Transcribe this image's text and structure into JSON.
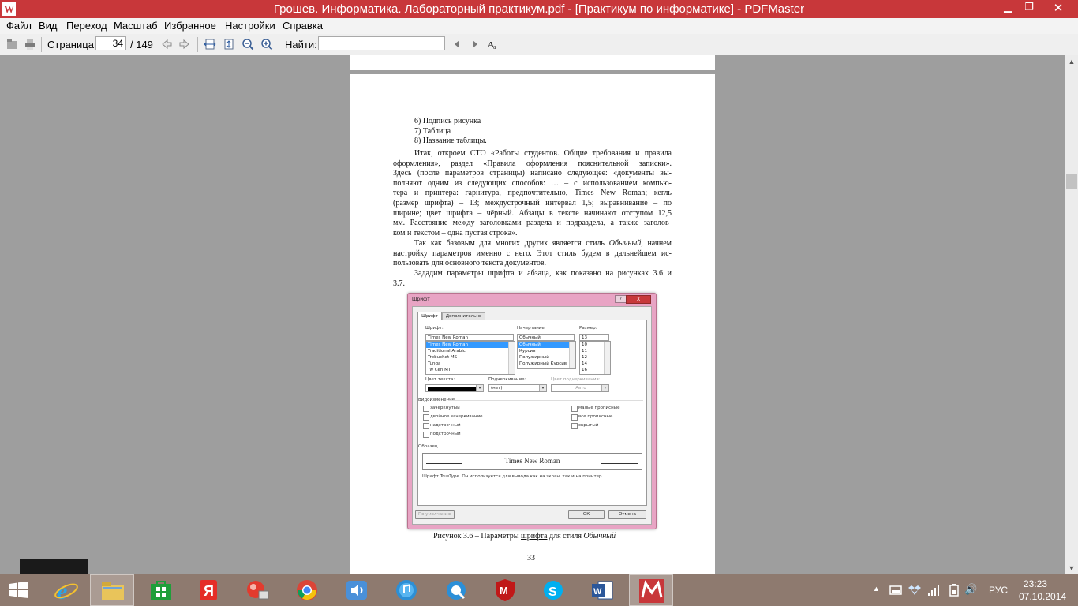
{
  "window": {
    "title": "Грошев. Информатика. Лабораторный практикум.pdf - [Практикум по информатике] - PDFMaster",
    "minimize_glyph": "▁",
    "restore_glyph": "❐",
    "close_glyph": "✕",
    "logo_glyph": "W",
    "colors": {
      "titlebar": "#c8373a"
    }
  },
  "menu": [
    "Файл",
    "Вид",
    "Переход",
    "Масштаб",
    "Избранное",
    "Настройки",
    "Справка"
  ],
  "toolbar": {
    "page_label": "Страница:",
    "page_value": "34",
    "page_total": "/ 149",
    "find_label": "Найти:",
    "find_value": ""
  },
  "document": {
    "list_items": [
      "6)  Подпись рисунка",
      "7)  Таблица",
      "8)  Название таблицы."
    ],
    "paragraph1_lines": [
      "Итак, откроем СТО «Работы студентов. Общие требования и правила",
      "оформления», раздел «Правила оформления пояснительной записки».",
      "Здесь (после параметров страницы) написано следующее: «документы вы-",
      "полняют одним из следующих способов: …  – с использованием компью-",
      "тера и принтера: гарнитура, предпочтительно, Times New Roman; кегль",
      "(размер шрифта) – 13; междустрочный интервал 1,5; выравнивание – по",
      "ширине; цвет шрифта – чёрный. Абзацы в тексте начинают отступом 12,5",
      "мм. Расстояние между заголовками раздела и подраздела, а также заголов-"
    ],
    "paragraph1_last": "ком и текстом – одна пустая строка».",
    "paragraph2_lines": [
      {
        "pre": "Так как базовым для многих других является стиль ",
        "em": "Обычный",
        "post": ", начнем"
      },
      {
        "pre": "настройку параметров именно с него. Этот стиль будем в дальнейшем ис-",
        "em": "",
        "post": ""
      }
    ],
    "paragraph2_last": "пользовать для основного текста документов.",
    "paragraph3_line": "Зададим параметры шрифта и абзаца, как показано на рисунках 3.6 и",
    "paragraph3_last": "3.7.",
    "caption": {
      "pre": "Рисунок 3.6 – Параметры ",
      "link": "шрифта",
      "mid": " для стиля ",
      "em": "Обычный"
    },
    "page_number": "33"
  },
  "font_dialog": {
    "title": "Шрифт",
    "help": "?",
    "close": "X",
    "tabs": [
      "Шрифт",
      "Дополнительно"
    ],
    "font_label": "Шрифт:",
    "font_value": "Times New Roman",
    "font_list": [
      "Times New Roman",
      "Traditional Arabic",
      "Trebuchet MS",
      "Tunga",
      "Tw Cen MT"
    ],
    "style_label": "Начертание:",
    "style_value": "Обычный",
    "style_list": [
      "Обычный",
      "Курсив",
      "Полужирный",
      "Полужирный Курсив"
    ],
    "size_label": "Размер:",
    "size_value": "13",
    "size_list": [
      "10",
      "11",
      "12",
      "14",
      "16"
    ],
    "color_label": "Цвет текста:",
    "underline_label": "Подчеркивание:",
    "underline_value": "(нет)",
    "underline_color_label": "Цвет подчеркивания:",
    "underline_color_value": "Авто",
    "effects_label": "Видоизменение",
    "effects_left": [
      "зачеркнутый",
      "двойное зачеркивание",
      "надстрочный",
      "подстрочный"
    ],
    "effects_right": [
      "малые прописные",
      "все прописные",
      "скрытый"
    ],
    "sample_label": "Образец",
    "sample_text": "Times New Roman",
    "sample_note": "Шрифт TrueType. Он используется для вывода как на экран, так и на принтер.",
    "default_button": "По умолчанию",
    "ok_button": "ОК",
    "cancel_button": "Отмена",
    "colors": {
      "frame": "#e8a4c4",
      "selection": "#3399ff"
    }
  },
  "taskbar": {
    "tray_arrow": "▲",
    "volume_glyph": "🔊",
    "language": "РУС",
    "time": "23:23",
    "date": "07.10.2014"
  }
}
